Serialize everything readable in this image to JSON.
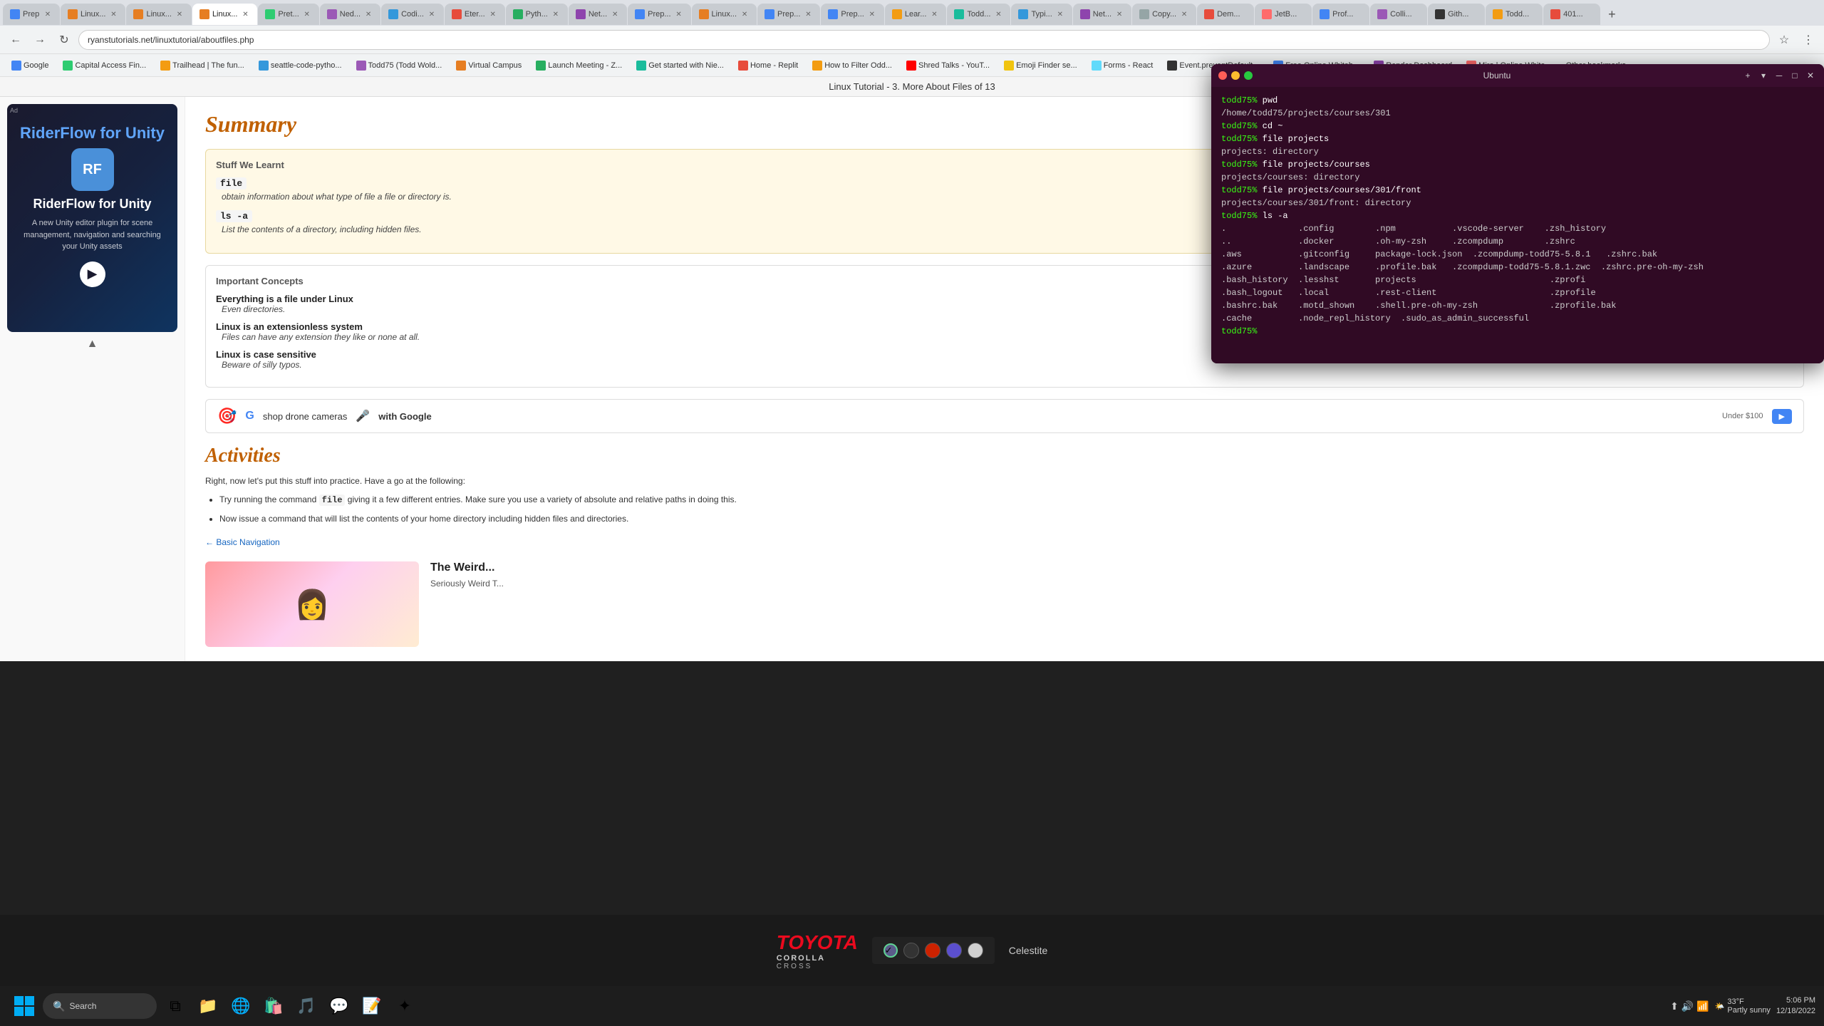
{
  "browser": {
    "tabs": [
      {
        "id": "t1",
        "label": "Prep",
        "active": false,
        "favicon_color": "#4285f4"
      },
      {
        "id": "t2",
        "label": "Linux...",
        "active": false,
        "favicon_color": "#e67e22"
      },
      {
        "id": "t3",
        "label": "Linux...",
        "active": false,
        "favicon_color": "#e67e22"
      },
      {
        "id": "t4",
        "label": "Linux...",
        "active": true,
        "favicon_color": "#e67e22"
      },
      {
        "id": "t5",
        "label": "Pret...",
        "active": false,
        "favicon_color": "#2ecc71"
      },
      {
        "id": "t6",
        "label": "Ned...",
        "active": false,
        "favicon_color": "#9b59b6"
      },
      {
        "id": "t7",
        "label": "Codi...",
        "active": false,
        "favicon_color": "#3498db"
      },
      {
        "id": "t8",
        "label": "Eter...",
        "active": false,
        "favicon_color": "#e74c3c"
      },
      {
        "id": "t9",
        "label": "Pyth...",
        "active": false,
        "favicon_color": "#27ae60"
      },
      {
        "id": "t10",
        "label": "Net...",
        "active": false,
        "favicon_color": "#8e44ad"
      },
      {
        "id": "t11",
        "label": "Prep...",
        "active": false,
        "favicon_color": "#4285f4"
      },
      {
        "id": "t12",
        "label": "Linux...",
        "active": false,
        "favicon_color": "#e67e22"
      },
      {
        "id": "t13",
        "label": "Prep...",
        "active": false,
        "favicon_color": "#4285f4"
      },
      {
        "id": "t14",
        "label": "Prep...",
        "active": false,
        "favicon_color": "#4285f4"
      },
      {
        "id": "t15",
        "label": "Lear...",
        "active": false,
        "favicon_color": "#f39c12"
      },
      {
        "id": "t16",
        "label": "Todd...",
        "active": false,
        "favicon_color": "#1abc9c"
      },
      {
        "id": "t17",
        "label": "Typi...",
        "active": false,
        "favicon_color": "#3498db"
      },
      {
        "id": "t18",
        "label": "Net...",
        "active": false,
        "favicon_color": "#8e44ad"
      },
      {
        "id": "t19",
        "label": "Copy...",
        "active": false,
        "favicon_color": "#95a5a6"
      },
      {
        "id": "t20",
        "label": "Dem...",
        "active": false,
        "favicon_color": "#e74c3c"
      },
      {
        "id": "t21",
        "label": "JetB...",
        "active": false,
        "favicon_color": "#ff6b6b"
      },
      {
        "id": "t22",
        "label": "Prof...",
        "active": false,
        "favicon_color": "#4285f4"
      },
      {
        "id": "t23",
        "label": "Colli...",
        "active": false,
        "favicon_color": "#9b59b6"
      },
      {
        "id": "t24",
        "label": "Gith...",
        "active": false,
        "favicon_color": "#333"
      },
      {
        "id": "t25",
        "label": "Todd...",
        "active": false,
        "favicon_color": "#f39c12"
      },
      {
        "id": "t26",
        "label": "401...",
        "active": false,
        "favicon_color": "#e74c3c"
      }
    ],
    "url": "ryanstutorials.net/linuxtutorial/aboutfiles.php",
    "bookmarks": [
      {
        "label": "Google",
        "color": "#4285f4"
      },
      {
        "label": "Capital Access Fin...",
        "color": "#2ecc71"
      },
      {
        "label": "Trailhead | The fun...",
        "color": "#f39c12"
      },
      {
        "label": "seattle-code-pytho...",
        "color": "#3498db"
      },
      {
        "label": "Todd75 (Todd Wold...",
        "color": "#9b59b6"
      },
      {
        "label": "Virtual Campus",
        "color": "#e67e22"
      },
      {
        "label": "Launch Meeting - Z...",
        "color": "#27ae60"
      },
      {
        "label": "Get started with Nie...",
        "color": "#1abc9c"
      },
      {
        "label": "Home - Replit",
        "color": "#e74c3c"
      },
      {
        "label": "How to Filter Odd...",
        "color": "#f39c12"
      },
      {
        "label": "Shred Talks - YouT...",
        "color": "#ff0000"
      },
      {
        "label": "Emoji Finder se...",
        "color": "#f1c40f"
      },
      {
        "label": "Forms - React",
        "color": "#61dafb"
      },
      {
        "label": "Event.preventDefault...",
        "color": "#333"
      },
      {
        "label": "Free Online Whiteb...",
        "color": "#4285f4"
      },
      {
        "label": "Render Dashboard",
        "color": "#8e44ad"
      },
      {
        "label": "Miro | Online White...",
        "color": "#ff6b6b"
      },
      {
        "label": "Other bookmarks",
        "color": "#95a5a6"
      }
    ]
  },
  "page_title_bar": {
    "text": "Linux Tutorial - 3. More About Files",
    "suffix": "of 13"
  },
  "ad": {
    "label": "Ad",
    "product": "RiderFlow for Unity",
    "icon": "RF",
    "description": "A new Unity editor plugin for scene management, navigation and searching your Unity assets",
    "btn_label": "▶"
  },
  "summary": {
    "title": "Summary",
    "stuff_we_learnt_title": "Stuff We Learnt",
    "items": [
      {
        "command": "file",
        "description": "obtain information about what type of file a file or directory is."
      },
      {
        "command": "ls -a",
        "description": "List the contents of a directory, including hidden files."
      }
    ],
    "important_concepts_title": "Important Concepts",
    "concepts": [
      {
        "title": "Everything is a file under Linux",
        "description": "Even directories."
      },
      {
        "title": "Linux is an extensionless system",
        "description": "Files can have any extension they like or none at all."
      },
      {
        "title": "Linux is case sensitive",
        "description": "Beware of silly typos."
      }
    ]
  },
  "ad_banner": {
    "logo_text": "G",
    "text": "shop drone cameras",
    "cta": "with Google",
    "price": "Under $100",
    "icon": "🎤"
  },
  "activities": {
    "title": "Activities",
    "intro": "Right, now let's put this stuff into practice. Have a go at the following:",
    "items": [
      {
        "text": "Try running the command file giving it a few different entries. Make sure you use a variety of absolute and relative paths in doing this.",
        "code": "file"
      },
      {
        "text": "Now issue a command that will list the contents of your home directory including hidden files and directories."
      }
    ]
  },
  "nav": {
    "prev_label": "Basic Navigation",
    "prev_url": "#"
  },
  "video": {
    "title": "The Weird...",
    "subtitle": "Seriously Weird T..."
  },
  "terminal": {
    "title": "Ubuntu",
    "lines": [
      {
        "type": "prompt",
        "prompt": "todd75%",
        "cmd": " pwd"
      },
      {
        "type": "output",
        "text": "/home/todd75/projects/courses/301"
      },
      {
        "type": "prompt",
        "prompt": "todd75%",
        "cmd": " cd ~"
      },
      {
        "type": "prompt",
        "prompt": "todd75%",
        "cmd": " file projects"
      },
      {
        "type": "output",
        "text": "projects: directory"
      },
      {
        "type": "prompt",
        "prompt": "todd75%",
        "cmd": " file projects/courses"
      },
      {
        "type": "output",
        "text": "projects/courses: directory"
      },
      {
        "type": "prompt",
        "prompt": "todd75%",
        "cmd": " file projects/courses/301/front"
      },
      {
        "type": "output",
        "text": "projects/courses/301/front: directory"
      },
      {
        "type": "prompt",
        "prompt": "todd75%",
        "cmd": " ls -a"
      },
      {
        "type": "output",
        "text": ".              .config        .npm           .vscode-server    .zsh_history"
      },
      {
        "type": "output",
        "text": "..             .docker        .oh-my-zsh     .zcompdump        .zshrc"
      },
      {
        "type": "output",
        "text": ".aws           .gitconfig     package-lock.json  .zcompdump-todd75-5.8.1   .zshrc.bak"
      },
      {
        "type": "output",
        "text": ".azure         .landscape     .profile.bak   .zcompdump-todd75-5.8.1.zwc  .zshrc.pre-oh-my-zsh"
      },
      {
        "type": "output",
        "text": ".bash_history  .lesshst       projects       .zprofi"
      },
      {
        "type": "output",
        "text": ".bash_logout   .local         .rest-client   .zprofile"
      },
      {
        "type": "output",
        "text": ".bashrc.bak    .motd_shown    .shell.pre-oh-my-zsh  .zprofile.bak"
      },
      {
        "type": "output",
        "text": ".cache         .node_repl_history  .sudo_as_admin_successful"
      },
      {
        "type": "prompt",
        "prompt": "todd75%",
        "cmd": " "
      }
    ]
  },
  "taskbar": {
    "start_icon": "⊞",
    "search_placeholder": "Search",
    "icons": [
      {
        "name": "task-view",
        "icon": "⧉",
        "active": false
      },
      {
        "name": "file-explorer",
        "icon": "📁",
        "active": false
      },
      {
        "name": "edge",
        "icon": "🌐",
        "active": false
      },
      {
        "name": "store",
        "icon": "🛍️",
        "active": false
      },
      {
        "name": "spotify",
        "icon": "🎵",
        "active": false
      },
      {
        "name": "discord",
        "icon": "💬",
        "active": false
      },
      {
        "name": "vscode",
        "icon": "📝",
        "active": false
      },
      {
        "name": "extra",
        "icon": "✦",
        "active": false
      }
    ],
    "sys_icons": [
      "🌐",
      "🔊",
      "📶",
      "🔋"
    ],
    "time": "5:06 PM",
    "date": "12/18/2022",
    "weather": "33°F",
    "weather_desc": "Partly sunny"
  },
  "bottom_ad": {
    "brand": "TOYOTA",
    "model": "COROLLA",
    "trim": "CROSS",
    "partner": "Celestite",
    "colors": [
      {
        "value": "#fff",
        "selected": true
      },
      {
        "value": "#222",
        "selected": false
      },
      {
        "value": "#cc2200",
        "selected": false
      },
      {
        "value": "#5b4fcf",
        "selected": false
      },
      {
        "value": "#e0e0e0",
        "selected": false
      }
    ]
  }
}
